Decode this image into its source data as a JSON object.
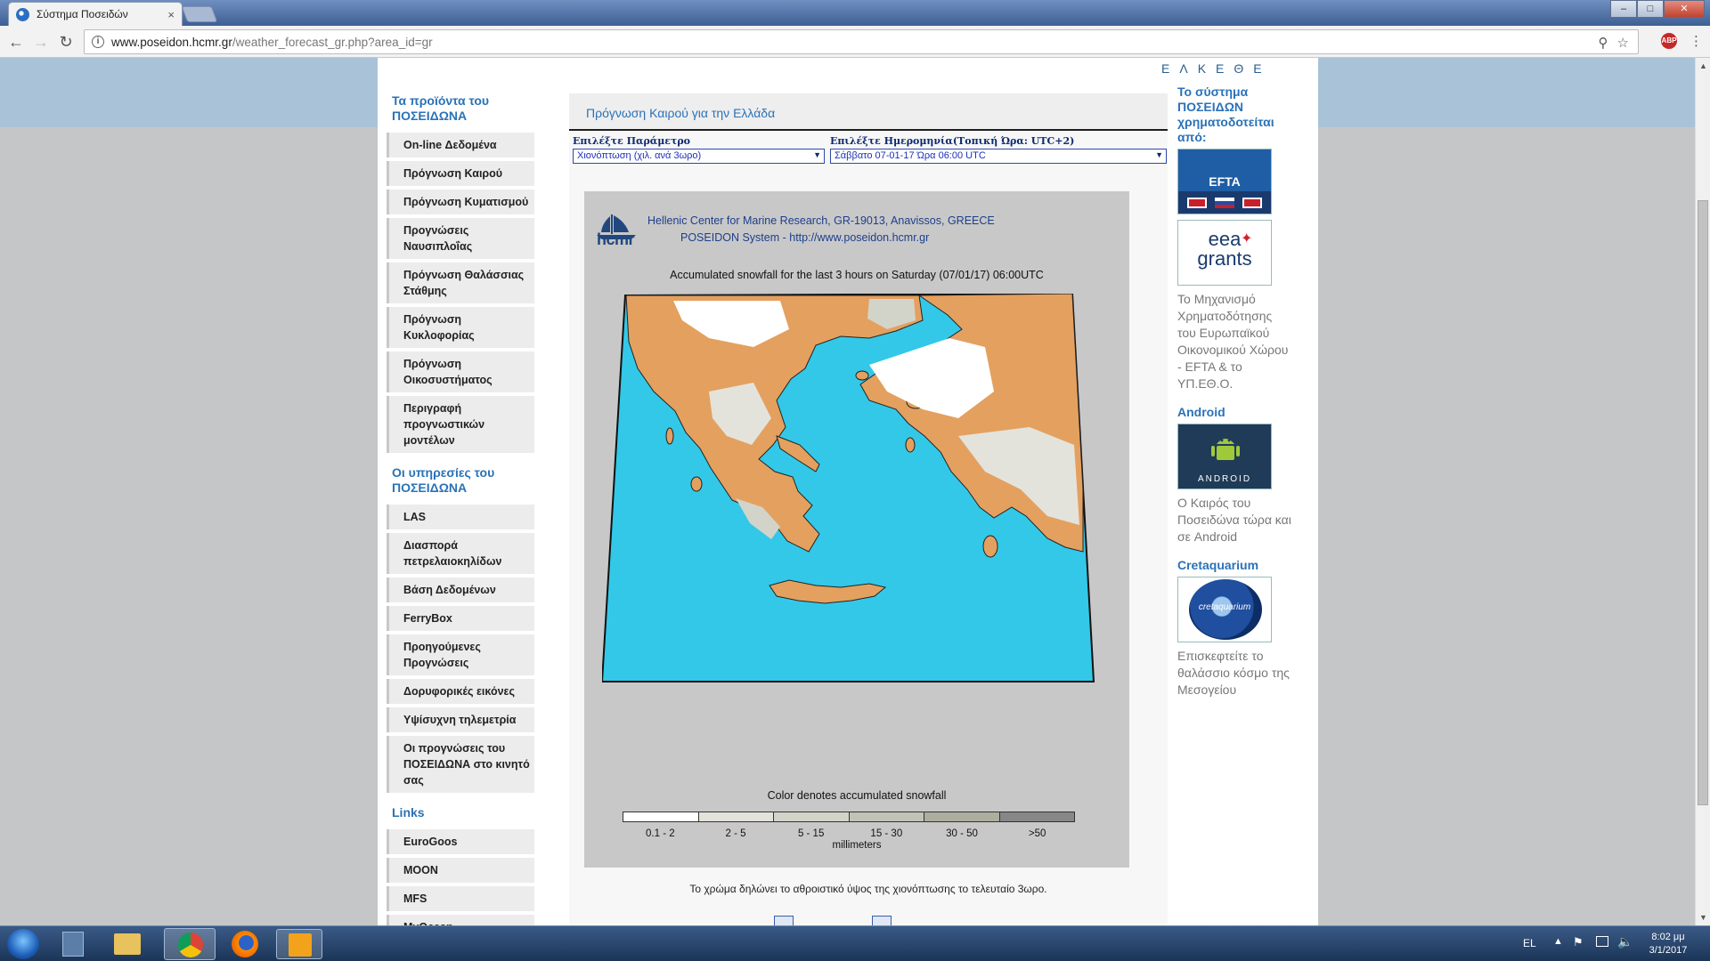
{
  "browser": {
    "tab_title": "Σύστημα Ποσειδών",
    "tab_close": "×",
    "url_host": "www.poseidon.hcmr.gr",
    "url_path": "/weather_forecast_gr.php?area_id=gr",
    "win_min": "‒",
    "win_max": "□",
    "win_close": "✕",
    "ext_badge": "ABP"
  },
  "header": {
    "ekethe": "ΕΛΚΕΘΕ"
  },
  "sidebar": {
    "products_heading": "Τα προϊόντα του ΠΟΣΕΙΔΩΝΑ",
    "products": [
      "On-line Δεδομένα",
      "Πρόγνωση Καιρού",
      "Πρόγνωση Κυματισμού",
      "Προγνώσεις Ναυσιπλοΐας",
      "Πρόγνωση Θαλάσσιας Στάθμης",
      "Πρόγνωση Κυκλοφορίας",
      "Πρόγνωση Οικοσυστήματος",
      "Περιγραφή προγνωστικών μοντέλων"
    ],
    "services_heading": "Οι υπηρεσίες του ΠΟΣΕΙΔΩΝΑ",
    "services": [
      "LAS",
      "Διασπορά πετρελαιοκηλίδων",
      "Βάση Δεδομένων",
      "FerryBox",
      "Προηγούμενες Προγνώσεις",
      "Δορυφορικές εικόνες",
      "Υψίσυχνη τηλεμετρία",
      "Οι προγνώσεις του ΠΟΣΕΙΔΩΝΑ στο κινητό σας"
    ],
    "links_heading": "Links",
    "links": [
      "EuroGoos",
      "MOON",
      "MFS",
      "MyOcean"
    ]
  },
  "main": {
    "title": "Πρόγνωση Καιρού για την Ελλάδα",
    "param_label": "Επιλέξτε Παράμετρο",
    "param_value": "Χιονόπτωση (χιλ. ανά 3ωρο)",
    "date_label": "Επιλέξτε Ημερομηνία(Τοπική Ώρα: UTC+2)",
    "date_value": "Σάββατο 07-01-17 Ώρα 06:00 UTC",
    "caption": "Το χρώμα δηλώνει το αθροιστικό ύψος της χιονόπτωσης το τελευταίο 3ωρο."
  },
  "chart_data": {
    "type": "heatmap",
    "logo_text": "hcmr",
    "header_line1": "Hellenic Center for Marine Research, GR-19013, Anavissos, GREECE",
    "header_line2": "POSEIDON System - http://www.poseidon.hcmr.gr",
    "title": "Accumulated snowfall for the last 3 hours on Saturday (07/01/17) 06:00UTC",
    "colorbar_title": "Color denotes accumulated snowfall",
    "unit": "millimeters",
    "bins": [
      "0.1 - 2",
      "2 - 5",
      "5 - 15",
      "15 - 30",
      "30 - 50",
      ">50"
    ],
    "bin_colors": [
      "#ffffff",
      "#e3e3dc",
      "#d3d4c9",
      "#c2c3b7",
      "#aeae9f",
      "#878787"
    ],
    "sea_color": "#33c8e8",
    "land_no_snow_color": "#e4a05f"
  },
  "right": {
    "funded_heading": "Το σύστημα ΠΟΣΕΙΔΩΝ χρηματοδοτείται από:",
    "efta_logo": "EFTA",
    "eea_line1": "eea",
    "eea_line2": "grants",
    "funding_text": "Το Μηχανισμό Χρηματοδότησης του Ευρωπαϊκού Οικονομικού Χώρου - EFTA & το ΥΠ.ΕΘ.Ο.",
    "android_heading": "Android",
    "android_logo": "ANDROID",
    "android_text": "Ο Καιρός του Ποσειδώνα τώρα και σε Android",
    "cretaquarium_heading": "Cretaquarium",
    "cretaquarium_logo": "cretaquarium",
    "cretaquarium_text": "Επισκεφτείτε το θαλάσσιο κόσμο της Μεσογείου"
  },
  "taskbar": {
    "lang": "EL",
    "time": "8:02 μμ",
    "date": "3/1/2017"
  }
}
